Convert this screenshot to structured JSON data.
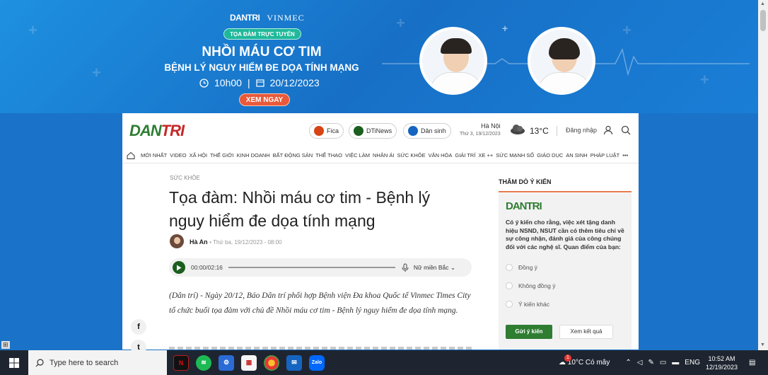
{
  "banner": {
    "brand_dantri": "DANTRI",
    "brand_vinmec": "VINMEC",
    "pill": "TỌA ĐÀM TRỰC TUYẾN",
    "title": "NHỒI MÁU CƠ TIM",
    "subtitle": "BỆNH LÝ NGUY HIỂM ĐE DỌA TÍNH MẠNG",
    "time": "10h00",
    "date_sep": "|",
    "date": "20/12/2023",
    "cta": "XEM NGAY"
  },
  "header": {
    "logo_main": "DAN",
    "logo_accent": "TRI",
    "chips": [
      {
        "label": "Fica",
        "color": "#d84315"
      },
      {
        "label": "DTiNews",
        "color": "#1b5e20"
      },
      {
        "label": "Dân sinh",
        "color": "#1565c0"
      }
    ],
    "city": "Hà Nội",
    "weekday_date": "Thứ 3, 19/12/2023",
    "temperature": "13°C",
    "login": "Đăng nhập"
  },
  "nav": {
    "items": [
      "Mới nhất",
      "Video",
      "Xã hội",
      "Thế giới",
      "Kinh doanh",
      "Bất động sản",
      "Thể thao",
      "Việc làm",
      "Nhân ái",
      "Sức khỏe",
      "Văn hóa",
      "Giải trí",
      "Xe ++",
      "Sức mạnh số",
      "Giáo dục",
      "An sinh",
      "Pháp luật",
      "•••"
    ]
  },
  "article": {
    "category": "Sức khỏe",
    "title": "Tọa đàm: Nhồi máu cơ tim - Bệnh lý nguy hiểm đe dọa tính mạng",
    "author": "Hà An",
    "date": "Thứ ba, 19/12/2023 - 08:00",
    "audio_time": "00:00/02:16",
    "voice": "Nữ miền Bắc",
    "lead": "(Dân trí) - Ngày 20/12, Báo Dân trí phối hợp Bệnh viện Đa khoa Quốc tế Vinmec Times City tổ chức buổi tọa đàm với chủ đề Nhồi máu cơ tim - Bệnh lý nguy hiểm đe dọa tính mạng."
  },
  "social": {
    "facebook": "f",
    "twitter": "t"
  },
  "poll": {
    "heading": "THĂM DÒ Ý KIẾN",
    "logo": "DANTRI",
    "question": "Có ý kiến cho rằng, việc xét tặng danh hiệu NSND, NSUT cần có thêm tiêu chí về sự công nhận, đánh giá của công chúng đối với các nghệ sĩ. Quan điểm của bạn:",
    "options": [
      "Đồng ý",
      "Không đồng ý",
      "Ý kiến khác"
    ],
    "vote_label": "Gửi ý kiến",
    "results_label": "Xem kết quả"
  },
  "taskbar": {
    "search_placeholder": "Type here to search",
    "weather": "10°C",
    "weather_text": "Có mây",
    "lang": "ENG",
    "time": "10:52 AM",
    "date": "12/19/2023",
    "badge": "1"
  },
  "colors": {
    "brand_green": "#2e7d32",
    "accent_orange": "#e6784a",
    "banner_blue": "#1a73c8"
  }
}
